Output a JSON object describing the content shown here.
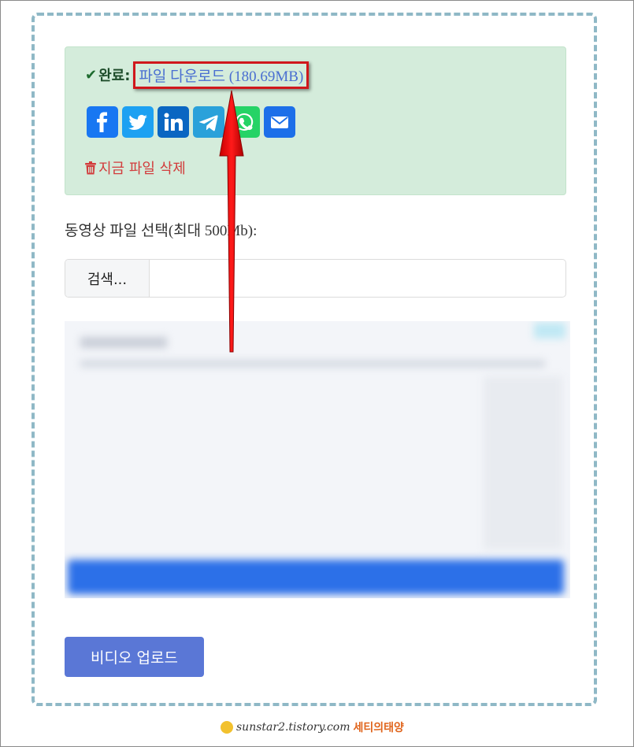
{
  "status": {
    "check_symbol": "✔",
    "label": "완료:",
    "download_link": "파일 다운로드 (180.69MB)"
  },
  "share": {
    "buttons": [
      {
        "name": "facebook",
        "icon": "facebook-icon",
        "color": "#1877f2"
      },
      {
        "name": "twitter",
        "icon": "twitter-icon",
        "color": "#1da1f2"
      },
      {
        "name": "linkedin",
        "icon": "linkedin-icon",
        "color": "#0a66c2"
      },
      {
        "name": "telegram",
        "icon": "telegram-icon",
        "color": "#2aa1da"
      },
      {
        "name": "whatsapp",
        "icon": "whatsapp-icon",
        "color": "#25d366"
      },
      {
        "name": "email",
        "icon": "email-icon",
        "color": "#1c6fe9"
      }
    ]
  },
  "delete": {
    "icon": "trash-icon",
    "label": "지금 파일 삭제"
  },
  "upload_form": {
    "field_label": "동영상 파일 선택(최대 500Mb):",
    "browse_label": "검색..."
  },
  "submit": {
    "label": "비디오 업로드"
  },
  "watermark": {
    "url": "sunstar2.tistory.com",
    "name": "세티의태양"
  },
  "colors": {
    "alert_bg": "#d4ecdb",
    "link": "#4a6fd1",
    "delete": "#d23c3c",
    "button": "#5a77d6",
    "highlight_border": "#d0181c",
    "arrow": "#ee0000"
  }
}
